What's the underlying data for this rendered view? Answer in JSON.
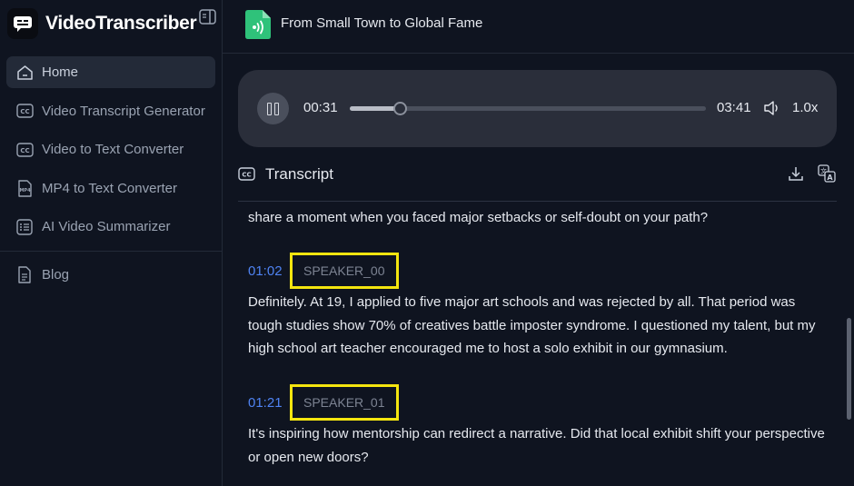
{
  "app": {
    "name": "VideoTranscriber",
    "logo_icon": "chat-bubble-icon",
    "collapse_icon": "sidebar-collapse-icon"
  },
  "sidebar": {
    "items": [
      {
        "label": "Home",
        "icon": "home-icon",
        "active": true
      },
      {
        "label": "Video Transcript Generator",
        "icon": "cc-icon",
        "active": false
      },
      {
        "label": "Video to Text Converter",
        "icon": "cc-icon",
        "active": false
      },
      {
        "label": "MP4 to Text Converter",
        "icon": "mp4-file-icon",
        "active": false
      },
      {
        "label": "AI Video Summarizer",
        "icon": "list-icon",
        "active": false
      }
    ],
    "secondary": [
      {
        "label": "Blog",
        "icon": "document-icon"
      }
    ]
  },
  "header": {
    "file_title": "From Small Town to Global Fame",
    "file_icon": "audio-file-icon"
  },
  "player": {
    "current_time": "00:31",
    "duration": "03:41",
    "progress": 0.14,
    "speed": "1.0x",
    "state": "playing"
  },
  "transcript": {
    "title": "Transcript",
    "leading_text": "share a moment when you faced major setbacks or self-doubt on your path?",
    "segments": [
      {
        "time": "01:02",
        "speaker": "SPEAKER_00",
        "text": "Definitely. At 19, I applied to five major art schools and was rejected by all. That period was tough studies show 70% of creatives battle imposter syndrome. I questioned my talent, but my high school art teacher encouraged me to host a solo exhibit in our gymnasium."
      },
      {
        "time": "01:21",
        "speaker": "SPEAKER_01",
        "text": "It's inspiring how mentorship can redirect a narrative. Did that local exhibit shift your perspective or open new doors?"
      }
    ]
  },
  "colors": {
    "background": "#0f1420",
    "accent_time": "#4f83f2",
    "highlight_box": "#f4e50f",
    "player_bg": "#2a2e3a",
    "file_icon_green": "#2fc27a"
  }
}
